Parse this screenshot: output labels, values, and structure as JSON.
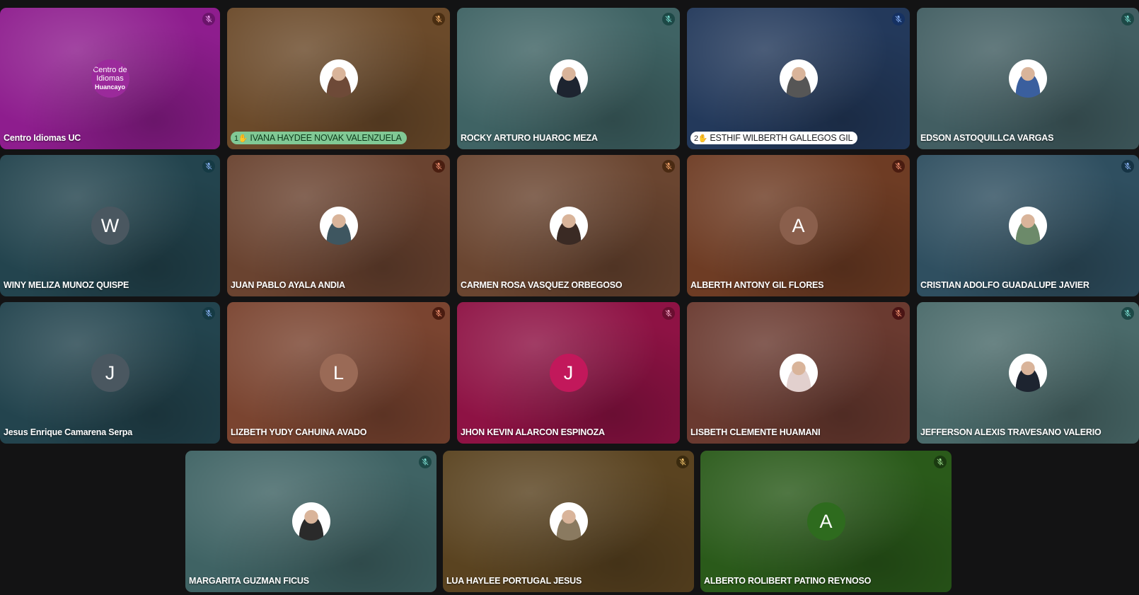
{
  "participants": [
    {
      "name": "Centro Idiomas UC",
      "avatar": "logo",
      "logo_line1": "Centro de",
      "logo_line2": "Idiomas",
      "logo_line3": "Huancayo",
      "bg": "#8e1d8e",
      "mic_bg": "#6b146b",
      "mic_color": "#f0a0f0"
    },
    {
      "name": "IVANA HAYDEE NOVAK VALENZUELA",
      "avatar": "photo",
      "photo_color": "#6e4a38",
      "bg": "#6b4a2a",
      "mic_bg": "#4a2e12",
      "mic_color": "#f5b26b",
      "hand": "1",
      "pill": "green"
    },
    {
      "name": "ROCKY ARTURO HUAROC MEZA",
      "avatar": "photo",
      "photo_color": "#1d2430",
      "bg": "#3f6364",
      "mic_bg": "#1d4846",
      "mic_color": "#7ce0d4"
    },
    {
      "name": "ESTHIF WILBERTH GALLEGOS GIL",
      "avatar": "photo",
      "photo_color": "#565656",
      "bg": "#23395b",
      "mic_bg": "#153162",
      "mic_color": "#8ab4f8",
      "hand": "2",
      "pill": "white"
    },
    {
      "name": "EDSON ASTOQUILLCA VARGAS",
      "avatar": "photo",
      "photo_color": "#3a5f9e",
      "bg": "#425e62",
      "mic_bg": "#1d4846",
      "mic_color": "#7ce0d4"
    },
    {
      "name": "WINY MELIZA MUNOZ QUISPE",
      "avatar": "letter",
      "letter": "W",
      "letter_bg": "#4a5760",
      "bg": "#23444e",
      "mic_bg": "#153a44",
      "mic_color": "#8ab4f8"
    },
    {
      "name": "JUAN PABLO AYALA ANDIA",
      "avatar": "photo",
      "photo_color": "#3e5660",
      "bg": "#6a4330",
      "mic_bg": "#4a1e10",
      "mic_color": "#f08f70"
    },
    {
      "name": "CARMEN ROSA VASQUEZ ORBEGOSO",
      "avatar": "photo",
      "photo_color": "#3a2a24",
      "bg": "#6a4530",
      "mic_bg": "#4a2a12",
      "mic_color": "#f5a56b"
    },
    {
      "name": "ALBERTH ANTONY GIL FLORES",
      "avatar": "letter",
      "letter": "A",
      "letter_bg": "#8a5f4c",
      "bg": "#6e3c24",
      "mic_bg": "#4a1c10",
      "mic_color": "#f08f70"
    },
    {
      "name": "CRISTIAN ADOLFO GUADALUPE JAVIER",
      "avatar": "photo",
      "photo_color": "#6c8a6a",
      "bg": "#2f4f60",
      "mic_bg": "#153344",
      "mic_color": "#8ab4f8"
    },
    {
      "name": "Jesus Enrique Camarena Serpa",
      "avatar": "letter",
      "letter": "J",
      "letter_bg": "#4a5760",
      "bg": "#23444e",
      "mic_bg": "#153a44",
      "mic_color": "#8ab4f8"
    },
    {
      "name": "LIZBETH YUDY CAHUINA AVADO",
      "avatar": "letter",
      "letter": "L",
      "letter_bg": "#9a6a56",
      "bg": "#7a4430",
      "mic_bg": "#4a1c10",
      "mic_color": "#f08f70"
    },
    {
      "name": "JHON KEVIN ALARCON ESPINOZA",
      "avatar": "letter",
      "letter": "J",
      "letter_bg": "#c2185b",
      "bg": "#8e1244",
      "mic_bg": "#6a0e30",
      "mic_color": "#f0a0c0"
    },
    {
      "name": "LISBETH CLEMENTE HUAMANI",
      "avatar": "photo",
      "photo_color": "#e2d0ce",
      "bg": "#6a3a30",
      "mic_bg": "#4a1414",
      "mic_color": "#f08f70"
    },
    {
      "name": "JEFFERSON ALEXIS TRAVESANO VALERIO",
      "avatar": "photo",
      "photo_color": "#1d2430",
      "bg": "#4a6a6a",
      "mic_bg": "#1d4846",
      "mic_color": "#7ce0d4"
    },
    {
      "name": "MARGARITA GUZMAN FICUS",
      "avatar": "photo",
      "photo_color": "#2a2a2a",
      "bg": "#3f6364",
      "mic_bg": "#1d4846",
      "mic_color": "#7ce0d4"
    },
    {
      "name": "LUA HAYLEE PORTUGAL JESUS",
      "avatar": "photo",
      "photo_color": "#8a7a60",
      "bg": "#5a4320",
      "mic_bg": "#3a2a0e",
      "mic_color": "#f5c56b"
    },
    {
      "name": "ALBERTO ROLIBERT PATINO REYNOSO",
      "avatar": "letter",
      "letter": "A",
      "letter_bg": "#2e6b1e",
      "bg": "#2a5a1a",
      "mic_bg": "#1a3a10",
      "mic_color": "#a0e090"
    }
  ]
}
